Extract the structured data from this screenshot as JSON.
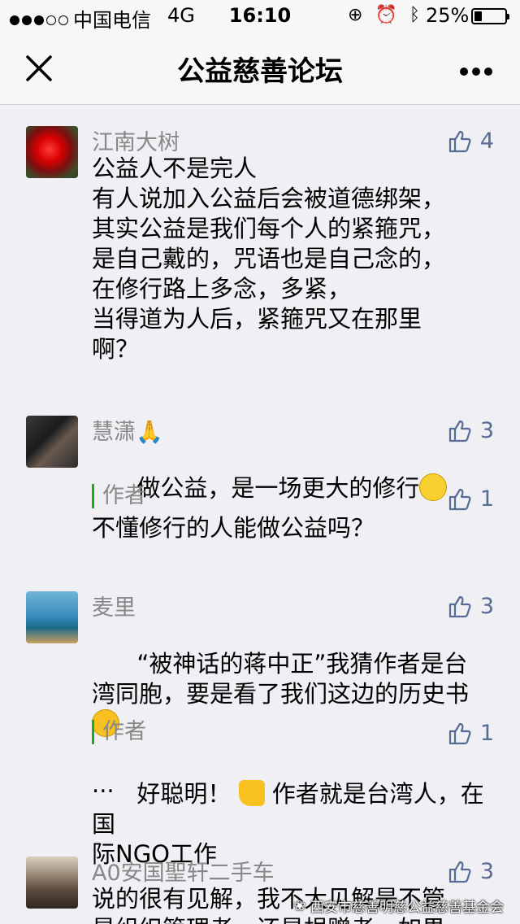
{
  "status_bar": {
    "carrier": "中国电信",
    "network": "4G",
    "time": "16:10",
    "battery": "25%",
    "battery_level": 0.25
  },
  "nav": {
    "title": "公益慈善论坛"
  },
  "comments": [
    {
      "name": "江南大树",
      "likes": "4",
      "text": "公益人不是完人\n有人说加入公益后会被道德绑架，\n其实公益是我们每个人的紧箍咒，\n是自己戴的，咒语也是自己念的，\n在修行路上多念，多紧，\n当得道为人后，紧箍咒又在那里\n啊？"
    },
    {
      "name": "慧潇🙏",
      "likes": "3",
      "text": "做公益，是一场更大的修行",
      "reply": {
        "label": "作者",
        "likes": "1",
        "text": "不懂修行的人能做公益吗？"
      }
    },
    {
      "name": "麦里",
      "likes": "3",
      "text": "“被神话的蒋中正”我猜作者是台湾同胞，要是看了我们这边的历史书",
      "text_cont": "...",
      "reply": {
        "label": "作者",
        "likes": "1",
        "text_a": "好聪明！",
        "text_b": "作者就是台湾人，在国\n际NGO工作"
      }
    },
    {
      "name": "A0安国聖轩二手车",
      "likes": "3",
      "text": "说的很有见解，我不大见解是不管\n是组织管理者，还是捐赠者，如果"
    }
  ],
  "watermark": "西安市慈善明慈公益慈善基金会"
}
